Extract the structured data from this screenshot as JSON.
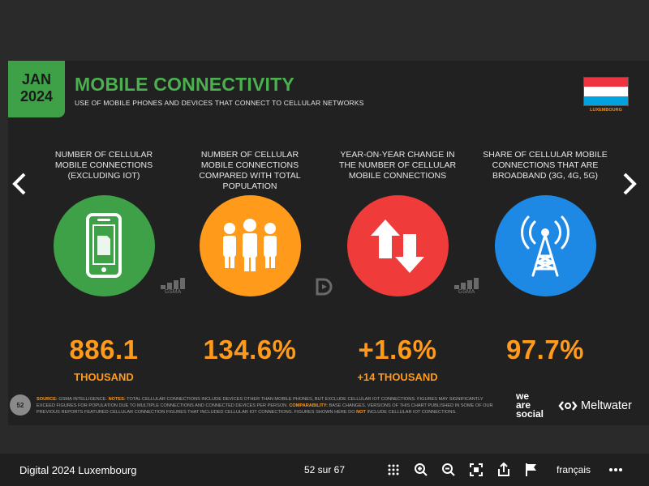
{
  "slide": {
    "date_line1": "JAN",
    "date_line2": "2024",
    "title": "MOBILE CONNECTIVITY",
    "subtitle": "USE OF MOBILE PHONES AND DEVICES THAT CONNECT TO CELLULAR NETWORKS",
    "country": "LUXEMBOURG",
    "metrics": [
      {
        "label": "NUMBER OF CELLULAR MOBILE CONNECTIONS (EXCLUDING IOT)",
        "value": "886.1",
        "sub": "THOUSAND",
        "color": "#3ea047",
        "icon": "mobile-phone-icon"
      },
      {
        "label": "NUMBER OF CELLULAR MOBILE CONNECTIONS COMPARED WITH TOTAL POPULATION",
        "value": "134.6%",
        "sub": "",
        "color": "#ff9a1a",
        "icon": "people-icon"
      },
      {
        "label": "YEAR-ON-YEAR CHANGE IN THE NUMBER OF CELLULAR MOBILE CONNECTIONS",
        "value": "+1.6%",
        "sub": "+14 THOUSAND",
        "color": "#ef3b39",
        "icon": "up-down-arrows-icon"
      },
      {
        "label": "SHARE OF CELLULAR MOBILE CONNECTIONS THAT ARE BROADBAND (3G, 4G, 5G)",
        "value": "97.7%",
        "sub": "",
        "color": "#1e88e5",
        "icon": "cell-tower-icon"
      }
    ],
    "source_logo_text": "GSMA",
    "page_number": "52",
    "notes": {
      "source_key": "SOURCE:",
      "source_text": " GSMA INTELLIGENCE. ",
      "notes_key": "NOTES:",
      "notes_text": " TOTAL CELLULAR CONNECTIONS INCLUDE DEVICES OTHER THAN MOBILE PHONES, BUT EXCLUDE CELLULAR IOT CONNECTIONS. FIGURES MAY SIGNIFICANTLY EXCEED FIGURES FOR POPULATION DUE TO MULTIPLE CONNECTIONS AND CONNECTED DEVICES PER PERSON. ",
      "comparability_key": "COMPARABILITY:",
      "comparability_text": " BASE CHANGES. VERSIONS OF THIS CHART PUBLISHED IN SOME OF OUR PREVIOUS REPORTS FEATURED CELLULAR CONNECTION FIGURES THAT INCLUDED CELLULAR IOT CONNECTIONS. FIGURES SHOWN HERE DO ",
      "not_key": "NOT",
      "end_text": " INCLUDE CELLULAR IOT CONNECTIONS."
    },
    "brand1": [
      "we",
      "are",
      "social"
    ],
    "brand2": "Meltwater"
  },
  "toolbar": {
    "doc_title": "Digital 2024 Luxembourg",
    "page_count": "52 sur 67",
    "language": "français",
    "icons": [
      "grid-icon",
      "zoom-in-icon",
      "zoom-out-icon",
      "fullscreen-icon",
      "share-icon",
      "flag-icon",
      "more-icon"
    ]
  },
  "colors": {
    "accent_green": "#4bb04f",
    "accent_orange": "#ff9a1a"
  }
}
